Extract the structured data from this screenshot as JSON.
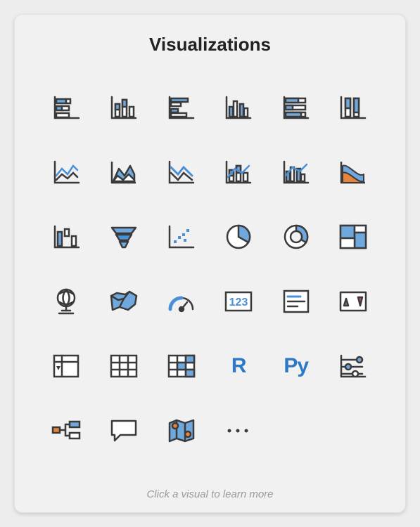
{
  "title": "Visualizations",
  "footer": "Click a visual to learn more",
  "colors": {
    "stroke": "#3A3A3A",
    "blue": "#6FA8DC",
    "blue2": "#4B8FD6",
    "orange": "#E7833B",
    "white": "#FFFFFF"
  },
  "labels": {
    "r": "R",
    "py": "Py",
    "kpi": "123"
  },
  "items": [
    {
      "name": "stacked-bar-horizontal-icon"
    },
    {
      "name": "stacked-bar-vertical-icon"
    },
    {
      "name": "clustered-bar-horizontal-icon"
    },
    {
      "name": "clustered-bar-vertical-icon"
    },
    {
      "name": "hundred-stacked-bar-horizontal-icon"
    },
    {
      "name": "hundred-stacked-column-icon"
    },
    {
      "name": "line-chart-icon"
    },
    {
      "name": "area-chart-icon"
    },
    {
      "name": "stacked-area-chart-icon"
    },
    {
      "name": "line-stacked-column-icon"
    },
    {
      "name": "line-clustered-column-icon"
    },
    {
      "name": "ribbon-chart-icon"
    },
    {
      "name": "waterfall-chart-icon"
    },
    {
      "name": "funnel-chart-icon"
    },
    {
      "name": "scatter-chart-icon"
    },
    {
      "name": "pie-chart-icon"
    },
    {
      "name": "donut-chart-icon"
    },
    {
      "name": "treemap-icon"
    },
    {
      "name": "map-globe-icon"
    },
    {
      "name": "filled-map-icon"
    },
    {
      "name": "gauge-icon"
    },
    {
      "name": "card-number-icon"
    },
    {
      "name": "multi-row-card-icon"
    },
    {
      "name": "kpi-icon"
    },
    {
      "name": "slicer-icon"
    },
    {
      "name": "table-icon"
    },
    {
      "name": "matrix-icon"
    },
    {
      "name": "r-visual-icon"
    },
    {
      "name": "python-visual-icon"
    },
    {
      "name": "key-influencers-icon"
    },
    {
      "name": "decomposition-tree-icon"
    },
    {
      "name": "qa-visual-icon"
    },
    {
      "name": "arcgis-map-icon"
    },
    {
      "name": "more-visuals-icon"
    }
  ]
}
